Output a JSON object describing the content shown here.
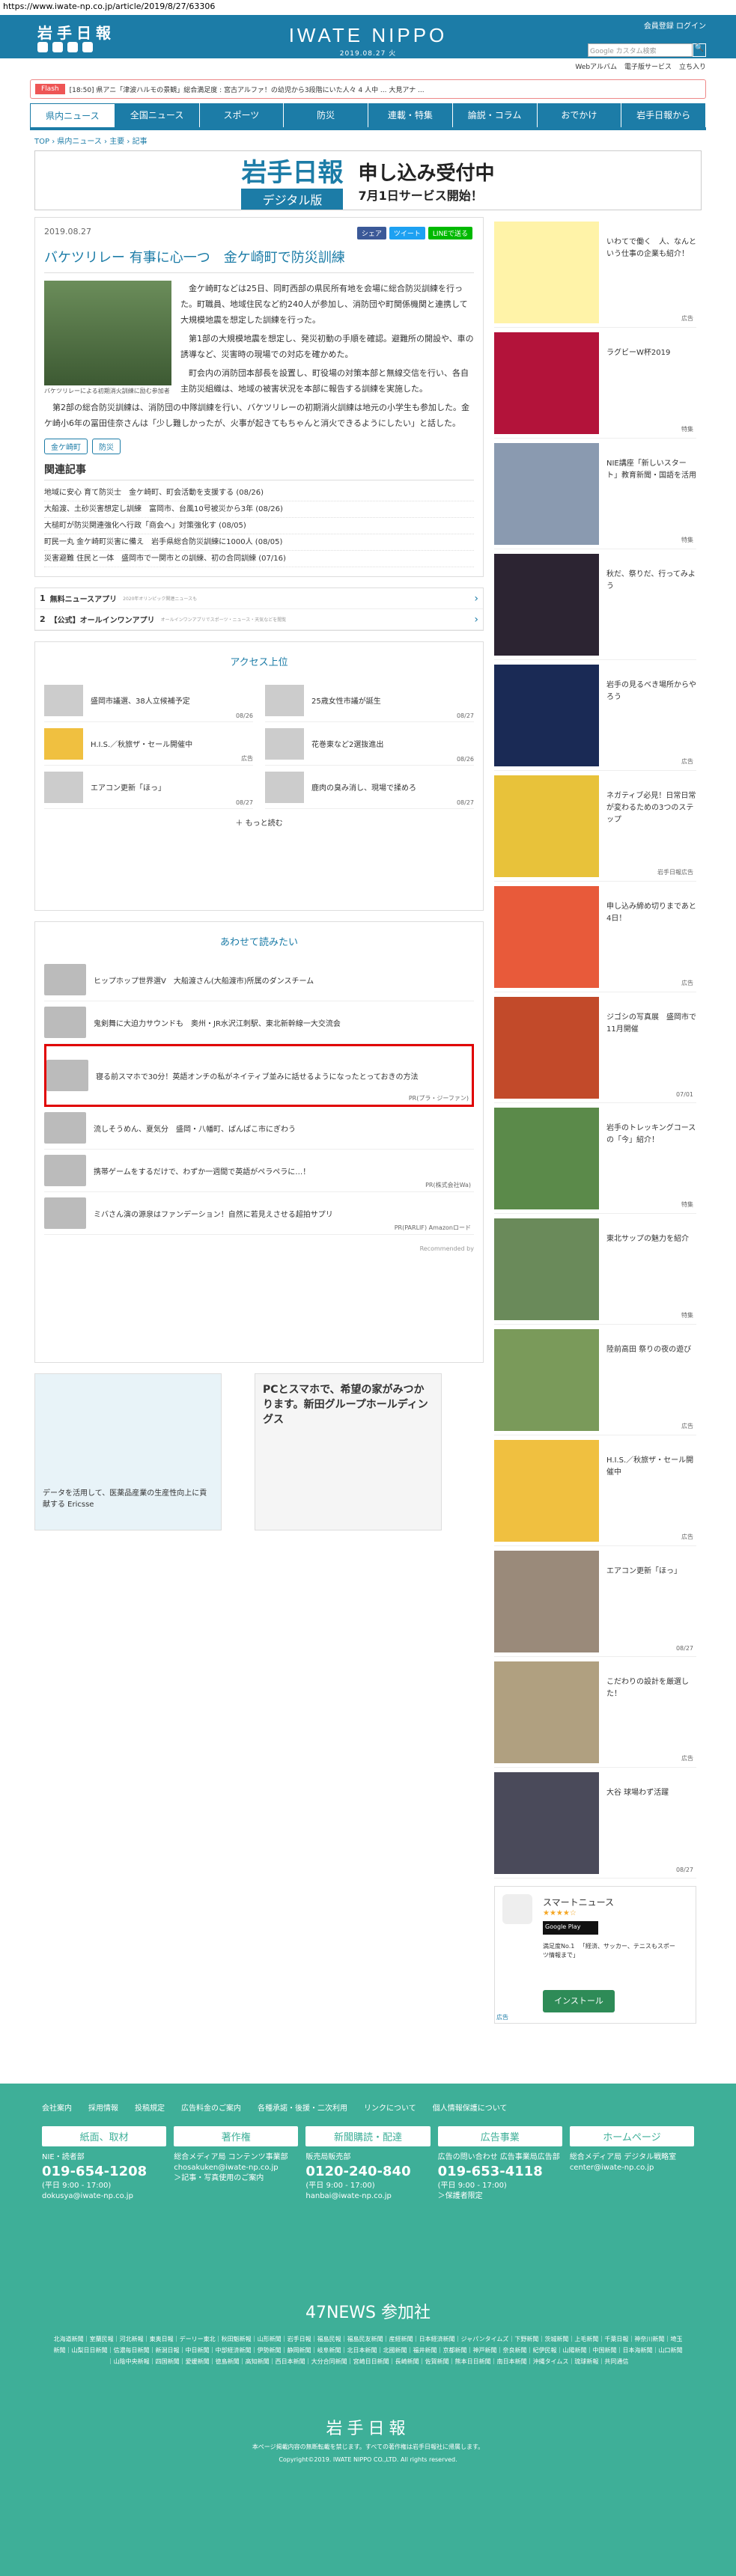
{
  "url": "https://www.iwate-np.co.jp/article/2019/8/27/63306",
  "header": {
    "logo": "岩手日報",
    "brand": "IWATE NIPPO",
    "date": "2019.08.27 火",
    "login": "会員登録  ログイン",
    "search_placeholder": "Google カスタム検索",
    "search_btn": "🔍",
    "links": [
      "Webアルバム",
      "電子版サービス",
      "立ち入り"
    ]
  },
  "flash": {
    "tag": "Flash",
    "text": "[18:50] 県アニ「津波ハルモの景観」総合満足度 : 宮古アルファ！の幼児から3段階にいた人々 4 人中 ... 大見アナ ..."
  },
  "nav": [
    "県内ニュース",
    "全国ニュース",
    "スポーツ",
    "防災",
    "連載・特集",
    "論説・コラム",
    "おでかけ",
    "岩手日報から"
  ],
  "crumb": [
    "TOP",
    "県内ニュース",
    "主要",
    "記事"
  ],
  "banner": {
    "b1": "岩手日報",
    "b1sub": "デジタル版",
    "b2": "申し込み受付中",
    "b3": "7月1日サービス開始！"
  },
  "article": {
    "date": "2019.08.27",
    "share": [
      "シェア",
      "ツイート",
      "LINEで送る"
    ],
    "title": "バケツリレー 有事に心一つ　金ケ崎町で防災訓練",
    "caption": "バケツリレーによる初期消火訓練に励む参加者",
    "paragraphs": [
      "金ケ崎町などは25日、同町西部の県民所有地を会場に総合防災訓練を行った。町職員、地域住民など約240人が参加し、消防団や町関係機関と連携して大規模地震を想定した訓練を行った。",
      "第1部の大規模地震を想定し、発災初動の手順を確認。避難所の開設や、車の誘導など、災害時の現場での対応を確かめた。",
      "町会内の消防団本部長を設置し、町役場の対策本部と無線交信を行い、各自主防災組織は、地域の被害状況を本部に報告する訓練を実施した。",
      "第2部の総合防災訓練は、消防団の中隊訓練を行い、バケツリレーの初期消火訓練は地元の小学生も参加した。金ケ崎小6年の冨田佳奈さんは「少し難しかったが、火事が起きてもちゃんと消火できるようにしたい」と話した。"
    ],
    "tags": [
      "金ケ崎町",
      "防災"
    ]
  },
  "related": {
    "heading": "関連記事",
    "items": [
      "地域に安心 育て防災士　金ケ崎町、町会活動を支援する (08/26)",
      "大船渡、土砂災害想定し訓練　富岡市、台風10号被災から3年 (08/26)",
      "大槌町が防災関連強化へ行政「商会へ」対策強化す (08/05)",
      "町民一丸 金ケ崎町災害に備え　岩手県総合防災訓練に1000人 (08/05)",
      "災害避難 住民と一体　盛岡市で一関市との訓練、初の合同訓練 (07/16)"
    ]
  },
  "apps": [
    {
      "num": "1",
      "name": "無料ニュースアプリ",
      "sub": "2020年オリンピック関連ニュースも",
      "arrow": "›"
    },
    {
      "num": "2",
      "name": "【公式】オールインワンアプリ",
      "sub": "オールインワンアプリでスポーツ・ニュース・天気などを閲覧",
      "arrow": "›"
    }
  ],
  "ranking": {
    "heading": "アクセス上位",
    "items": [
      {
        "t": "盛岡市議選、38人立候補予定",
        "d": "08/26"
      },
      {
        "t": "25歳女性市議が誕生",
        "d": "08/27"
      },
      {
        "t": "H.I.S.／秋旅ザ・セール開催中",
        "d": "広告"
      },
      {
        "t": "花巻東など2選抜進出",
        "d": "08/26"
      },
      {
        "t": "エアコン更新「ほっ」",
        "d": "08/27"
      },
      {
        "t": "鹿肉の臭み消し、現場で揉めろ",
        "d": "08/27"
      }
    ],
    "more": "もっと読む"
  },
  "recommend": {
    "heading": "あわせて読みたい",
    "items": [
      {
        "t": "ヒップホップ世界選V　大船渡さん(大船渡市)所属のダンスチーム",
        "pr": ""
      },
      {
        "t": "鬼剣舞に大迫力サウンドも　奥州・JR水沢江刺駅、東北新幹線一大交流会",
        "pr": ""
      },
      {
        "t": "寝る前スマホで30分！英語オンチの私がネイティブ並みに話せるようになったとっておきの方法",
        "pr": "PR(プラ・ジーファン)"
      },
      {
        "t": "流しそうめん、夏気分　盛岡・八幡町、ぱんぱこ市にぎわう",
        "pr": ""
      },
      {
        "t": "携帯ゲームをするだけで、わずか一週間で英語がペラペラに…！",
        "pr": "PR(株式会社Wa)"
      },
      {
        "t": "ミバさん演の源泉はファンデーション！自然に若見えさせる超拍サプリ",
        "pr": "PR(PARLIF) Amazonロード"
      }
    ],
    "footer": "Recommended by"
  },
  "ads": {
    "a1": "データを活用して、医薬品産業の生産性向上に貢献する Ericsse",
    "a2": "PCとスマホで、希望の家がみつかります。新田グループホールディングス"
  },
  "sidebar": [
    {
      "t": "いわてで働く　人、なんという仕事の企業も紹介！",
      "c": "広告"
    },
    {
      "t": "ラグビーW杯2019",
      "c": "特集"
    },
    {
      "t": "NIE講座「新しいスタート」教育新聞・国語を活用",
      "c": "特集"
    },
    {
      "t": "秋だ、祭りだ、行ってみよう",
      "c": ""
    },
    {
      "t": "岩手の見るべき場所からやろう",
      "c": "広告"
    },
    {
      "t": "ネガティブ必見！日常日常が変わるための3つのステップ",
      "c": "岩手日報広告"
    },
    {
      "t": "申し込み締め切りまであと4日！",
      "c": "広告"
    },
    {
      "t": "ジゴシの写真展　盛岡市で11月開催",
      "c": "07/01"
    },
    {
      "t": "岩手のトレッキングコースの「今」紹介！",
      "c": "特集"
    },
    {
      "t": "東北サップの魅力を紹介",
      "c": "特集"
    },
    {
      "t": "陸前高田 祭りの夜の遊び",
      "c": "広告"
    },
    {
      "t": "H.I.S.／秋旅ザ・セール開催中",
      "c": "広告"
    },
    {
      "t": "エアコン更新「ほっ」",
      "c": "08/27"
    },
    {
      "t": "こだわりの設計を厳選した！",
      "c": "広告"
    },
    {
      "t": "大谷 球場わず活躍",
      "c": "08/27"
    }
  ],
  "sideapp": {
    "name": "スマートニュース",
    "stars": "★★★★☆",
    "gp": "Google Play",
    "desc": "満足度No.1 　「経済、サッカー、テニスもスポーツ情報まで」",
    "install": "インストール",
    "label": "広告"
  },
  "footer": {
    "links": [
      "会社案内",
      "採用情報",
      "投稿規定",
      "広告料金のご案内",
      "各種承諾・後援・二次利用",
      "リンクについて",
      "個人情報保護について"
    ],
    "cols": [
      {
        "h": "紙面、取材",
        "l1": "NIE・読者部",
        "p": "019-654-1208",
        "l2": "(平日 9:00 - 17:00)",
        "l3": "dokusya@iwate-np.co.jp"
      },
      {
        "h": "著作権",
        "l1": "総合メディア局 コンテンツ事業部",
        "p": "",
        "l2": "chosakuken@iwate-np.co.jp",
        "l3": "＞記事・写真使用のご案内"
      },
      {
        "h": "新聞購読・配達",
        "l1": "販売局販売部",
        "p": "0120-240-840",
        "l2": "(平日 9:00 - 17:00)",
        "l3": "hanbai@iwate-np.co.jp"
      },
      {
        "h": "広告事業",
        "l1": "広告の問い合わせ 広告事業局広告部",
        "p": "019-653-4118",
        "l2": "(平日 9:00 - 17:00)",
        "l3": "＞保護者限定"
      },
      {
        "h": "ホームページ",
        "l1": "総合メディア局 デジタル戦略室",
        "p": "",
        "l2": "center@iwate-np.co.jp",
        "l3": ""
      }
    ],
    "n47": "47NEWS 参加社",
    "papers": "北海道新聞｜室蘭民報｜河北新報｜東奥日報｜デーリー東北｜秋田魁新報｜山形新聞｜岩手日報｜福島民報｜福島民友新聞｜産経新聞｜日本経済新聞｜ジャパンタイムズ｜下野新聞｜茨城新聞｜上毛新聞｜千葉日報｜神奈川新聞｜埼玉新聞｜山梨日日新聞｜信濃毎日新聞｜新潟日報｜中日新聞｜中部経済新聞｜伊勢新聞｜静岡新聞｜岐阜新聞｜北日本新聞｜北國新聞｜福井新聞｜京都新聞｜神戸新聞｜奈良新聞｜紀伊民報｜山陽新聞｜中国新聞｜日本海新聞｜山口新聞｜山陰中央新報｜四国新聞｜愛媛新聞｜徳島新聞｜高知新聞｜西日本新聞｜大分合同新聞｜宮崎日日新聞｜長崎新聞｜佐賀新聞｜熊本日日新聞｜南日本新聞｜沖縄タイムス｜琉球新報｜共同通信",
    "logo": "岩手日報",
    "copy1": "本ページ掲載内容の無断転載を禁じます。すべての著作権は岩手日報社に帰属します。",
    "copy2": "Copyright©2019. IWATE NIPPO CO.,LTD. All rights reserved."
  }
}
